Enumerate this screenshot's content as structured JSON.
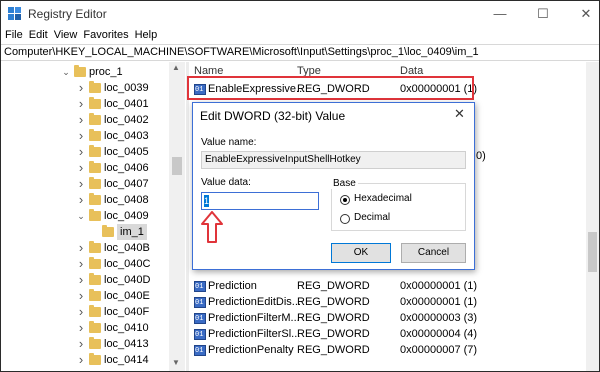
{
  "window": {
    "title": "Registry Editor",
    "controls": {
      "minimize": "—",
      "maximize": "☐",
      "close": "✕"
    }
  },
  "menu": [
    "File",
    "Edit",
    "View",
    "Favorites",
    "Help"
  ],
  "address": "Computer\\HKEY_LOCAL_MACHINE\\SOFTWARE\\Microsoft\\Input\\Settings\\proc_1\\loc_0409\\im_1",
  "tree": {
    "items": [
      {
        "label": "proc_1",
        "expanded": true,
        "level": 0
      },
      {
        "label": "loc_0039",
        "expanded": false,
        "level": 1
      },
      {
        "label": "loc_0401",
        "expanded": false,
        "level": 1
      },
      {
        "label": "loc_0402",
        "expanded": false,
        "level": 1
      },
      {
        "label": "loc_0403",
        "expanded": false,
        "level": 1
      },
      {
        "label": "loc_0405",
        "expanded": false,
        "level": 1
      },
      {
        "label": "loc_0406",
        "expanded": false,
        "level": 1
      },
      {
        "label": "loc_0407",
        "expanded": false,
        "level": 1
      },
      {
        "label": "loc_0408",
        "expanded": false,
        "level": 1
      },
      {
        "label": "loc_0409",
        "expanded": true,
        "level": 1
      },
      {
        "label": "im_1",
        "expanded": null,
        "level": 2,
        "selected": true
      },
      {
        "label": "loc_040B",
        "expanded": false,
        "level": 1
      },
      {
        "label": "loc_040C",
        "expanded": false,
        "level": 1
      },
      {
        "label": "loc_040D",
        "expanded": false,
        "level": 1
      },
      {
        "label": "loc_040E",
        "expanded": false,
        "level": 1
      },
      {
        "label": "loc_040F",
        "expanded": false,
        "level": 1
      },
      {
        "label": "loc_0410",
        "expanded": false,
        "level": 1
      },
      {
        "label": "loc_0413",
        "expanded": false,
        "level": 1
      },
      {
        "label": "loc_0414",
        "expanded": false,
        "level": 1
      }
    ]
  },
  "values": {
    "columns": {
      "name": "Name",
      "type": "Type",
      "data": "Data"
    },
    "top_rows": [
      {
        "name": "EnableExpressive...",
        "type": "REG_DWORD",
        "data": "0x00000001 (1)"
      }
    ],
    "peek_rows": [
      {
        "data": "0)"
      },
      {
        "data": ""
      },
      {
        "data": ""
      },
      {
        "data": ""
      },
      {
        "data": ""
      }
    ],
    "rows": [
      {
        "name": "Prediction",
        "type": "REG_DWORD",
        "data": "0x00000001 (1)"
      },
      {
        "name": "PredictionEditDis...",
        "type": "REG_DWORD",
        "data": "0x00000001 (1)"
      },
      {
        "name": "PredictionFilterM...",
        "type": "REG_DWORD",
        "data": "0x00000003 (3)"
      },
      {
        "name": "PredictionFilterSl...",
        "type": "REG_DWORD",
        "data": "0x00000004 (4)"
      },
      {
        "name": "PredictionPenalty",
        "type": "REG_DWORD",
        "data": "0x00000007 (7)"
      }
    ]
  },
  "dialog": {
    "title": "Edit DWORD (32-bit) Value",
    "close": "✕",
    "value_name_label": "Value name:",
    "value_name": "EnableExpressiveInputShellHotkey",
    "value_data_label": "Value data:",
    "value_data": "1",
    "base_label": "Base",
    "radio_hex": "Hexadecimal",
    "radio_dec": "Decimal",
    "selected_base": "Hexadecimal",
    "ok": "OK",
    "cancel": "Cancel"
  },
  "accent_colors": {
    "highlight": "#e0343a",
    "dialog_border": "#3d6fd6",
    "folder": "#e8c05a"
  }
}
